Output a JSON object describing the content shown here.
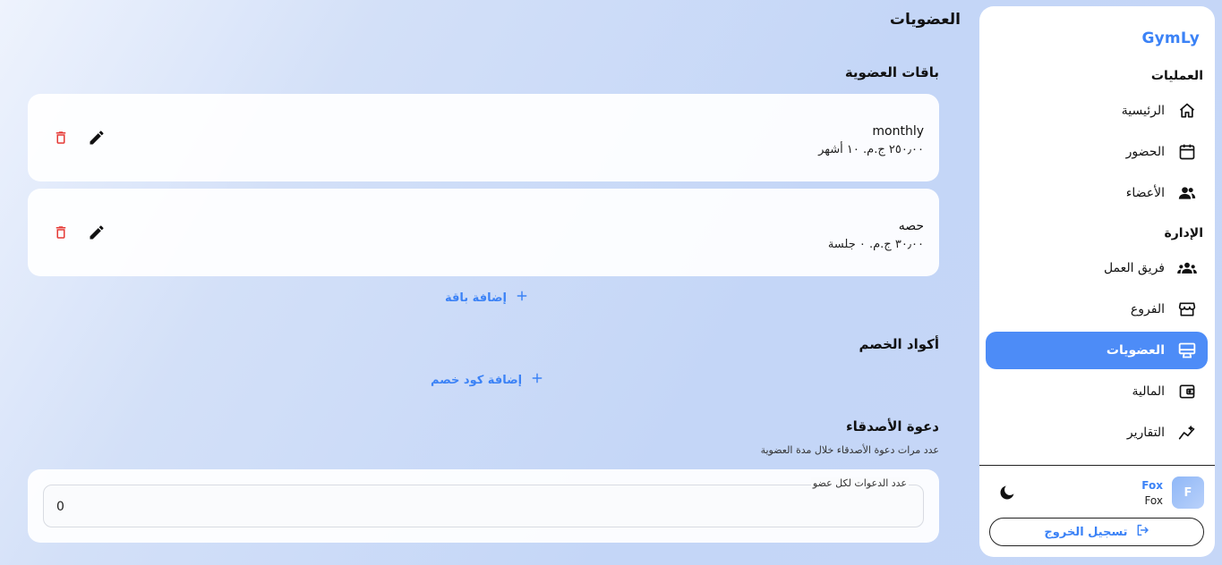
{
  "sidebar": {
    "brand": "GymLy",
    "sections": [
      {
        "title": "العمليات",
        "items": [
          {
            "label": "الرئيسية",
            "icon": "home-icon"
          },
          {
            "label": "الحضور",
            "icon": "calendar-icon"
          },
          {
            "label": "الأعضاء",
            "icon": "members-icon"
          }
        ]
      },
      {
        "title": "الإدارة",
        "items": [
          {
            "label": "فريق العمل",
            "icon": "team-icon"
          },
          {
            "label": "الفروع",
            "icon": "store-icon"
          },
          {
            "label": "العضويات",
            "icon": "membership-card-icon",
            "active": true
          },
          {
            "label": "المالية",
            "icon": "wallet-icon"
          },
          {
            "label": "التقارير",
            "icon": "analytics-icon"
          }
        ]
      }
    ],
    "user": {
      "avatar_letter": "F",
      "name": "Fox",
      "subtitle": "Fox"
    },
    "logout_label": "تسجيل الخروج"
  },
  "main": {
    "page_title": "العضويات",
    "plans_heading": "باقات العضوية",
    "plans": [
      {
        "name": "monthly",
        "detail": "٢٥٠٫٠٠ ج.م. ١٠ أشهر"
      },
      {
        "name": "حصه",
        "detail": "٣٠٫٠٠ ج.م. ٠ جلسة"
      }
    ],
    "add_plan_label": "إضافة باقة",
    "discounts_heading": "أكواد الخصم",
    "add_discount_label": "إضافة كود خصم",
    "invite_heading": "دعوة الأصدقاء",
    "invite_hint": "عدد مرات دعوة الأصدقاء خلال مدة العضوية",
    "invite_field_label": "عدد الدعوات لكل عضو",
    "invite_field_value": "0"
  },
  "colors": {
    "accent": "#3b82f6",
    "active_nav": "#4d8cf7",
    "delete": "#e53935"
  }
}
